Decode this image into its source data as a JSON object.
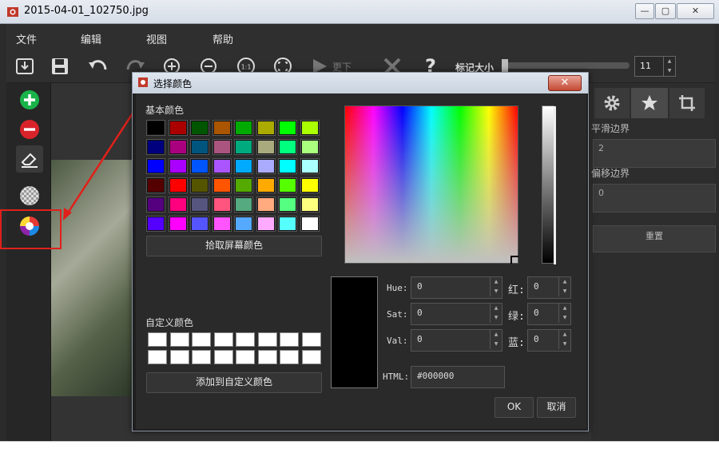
{
  "window": {
    "title": "2015-04-01_102750.jpg"
  },
  "menu": [
    "文件",
    "编辑",
    "视图",
    "帮助"
  ],
  "toolbar": {
    "next_label": "更下",
    "marker_size_label": "标记大小",
    "marker_size_value": "11",
    "marker_size_fraction": 0.0
  },
  "right_panel": {
    "smooth_label": "平滑边界",
    "smooth_value": "2",
    "offset_label": "偏移边界",
    "offset_value": "0",
    "reset_label": "重置"
  },
  "dialog": {
    "title": "选择颜色",
    "basic_colors_label": "基本颜色",
    "basic_colors": [
      [
        "#000000",
        "#aa0000",
        "#005500",
        "#aa5500",
        "#00aa00",
        "#aaaa00",
        "#00ff00",
        "#aaff00"
      ],
      [
        "#00007f",
        "#aa007f",
        "#00557f",
        "#aa557f",
        "#00aa7f",
        "#aaaa7f",
        "#00ff7f",
        "#aaff7f"
      ],
      [
        "#0000ff",
        "#aa00ff",
        "#0055ff",
        "#aa55ff",
        "#00aaff",
        "#aaaaff",
        "#00ffff",
        "#aaffff"
      ],
      [
        "#550000",
        "#ff0000",
        "#555500",
        "#ff5500",
        "#55aa00",
        "#ffaa00",
        "#55ff00",
        "#ffff00"
      ],
      [
        "#55007f",
        "#ff007f",
        "#55557f",
        "#ff557f",
        "#55aa7f",
        "#ffaa7f",
        "#55ff7f",
        "#ffff7f"
      ],
      [
        "#5500ff",
        "#ff00ff",
        "#5555ff",
        "#ff55ff",
        "#55aaff",
        "#ffaaff",
        "#55ffff",
        "#ffffff"
      ]
    ],
    "pick_screen_label": "拾取屏幕颜色",
    "custom_colors_label": "自定义颜色",
    "add_custom_label": "添加到自定义颜色",
    "hue_label": "Hue:",
    "hue_value": "0",
    "sat_label": "Sat:",
    "sat_value": "0",
    "val_label": "Val:",
    "val_value": "0",
    "red_label": "红:",
    "red_value": "0",
    "green_label": "绿:",
    "green_value": "0",
    "blue_label": "蓝:",
    "blue_value": "0",
    "html_label": "HTML:",
    "html_value": "#000000",
    "ok_label": "OK",
    "cancel_label": "取消",
    "current_color": "#000000"
  },
  "colors": {
    "annotation": "#e0201a",
    "add_green": "#19b34a",
    "remove_red": "#d8232a"
  }
}
